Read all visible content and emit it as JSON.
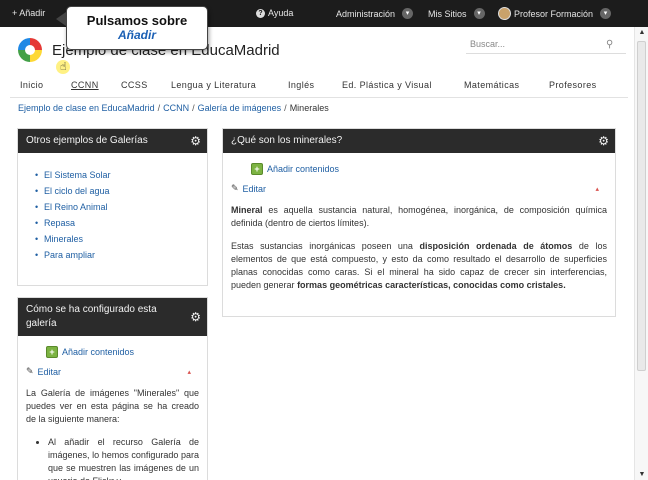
{
  "dockbar": {
    "add": "+ Añadir",
    "help": "Ayuda",
    "admin": "Administración",
    "sites": "Mis Sitios",
    "user": "Profesor Formación"
  },
  "tooltip": {
    "title": "Pulsamos sobre",
    "subtitle": "Añadir"
  },
  "header": {
    "site_title": "Ejemplo de clase en EducaMadrid",
    "search_placeholder": "Buscar..."
  },
  "nav": {
    "items": [
      "Inicio",
      "CCNN",
      "CCSS",
      "Lengua y Literatura",
      "Inglés",
      "Ed. Plástica y Visual",
      "Matemáticas",
      "Profesores"
    ],
    "active": "CCNN"
  },
  "breadcrumb": [
    "Ejemplo de clase en EducaMadrid",
    "CCNN",
    "Galería de imágenes",
    "Minerales"
  ],
  "left_portlet1": {
    "title": "Otros ejemplos de Galerías",
    "links": [
      "El Sistema Solar",
      "El ciclo del agua",
      "El Reino Animal",
      "Repasa",
      "Minerales",
      "Para ampliar"
    ]
  },
  "left_portlet2": {
    "title": "Cómo se ha configurado esta galería",
    "add_content": "Añadir contenidos",
    "edit": "Editar",
    "paragraph": "La Galería de imágenes \"Minerales\" que puedes ver en esta página se ha creado de la siguiente manera:",
    "bullet": "Al añadir el recurso Galería de imágenes, lo hemos configurado para que se muestren las imágenes de un usuario de Flickr y"
  },
  "main_portlet": {
    "title": "¿Qué son los minerales?",
    "add_content": "Añadir contenidos",
    "edit": "Editar",
    "p1_bold": "Mineral",
    "p1_rest": " es aquella sustancia natural, homogénea, inorgánica, de composición química definida (dentro de ciertos límites).",
    "p2_a": "Estas sustancias inorgánicas poseen una ",
    "p2_b": "disposición ordenada de átomos",
    "p2_c": " de los elementos de que está compuesto, y esto da como resultado el desarrollo de superficies planas conocidas como caras. Si el mineral ha sido capaz de crecer sin interferencias, pueden generar ",
    "p2_d": "formas geométricas características, conocidas como cristales."
  },
  "colors": {
    "dockbar": "#1c1c1c",
    "link": "#1f5fa3",
    "portlet_header": "#2b2b2b",
    "tooltip_accent": "#1a5fb4"
  }
}
